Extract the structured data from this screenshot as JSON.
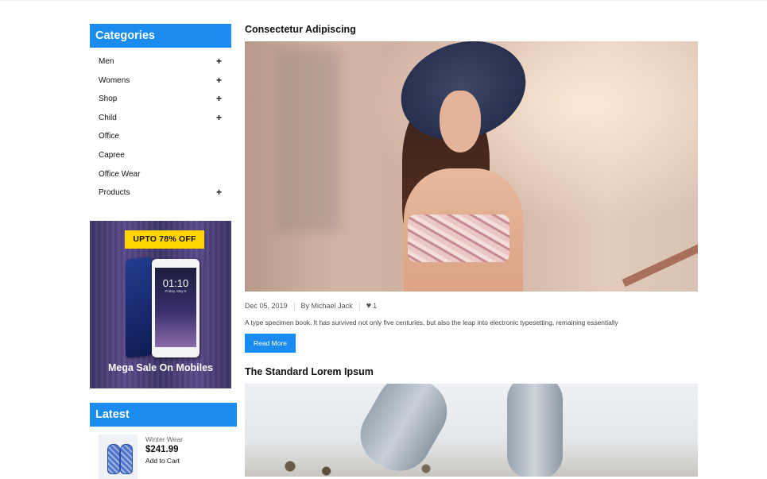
{
  "sidebar": {
    "categories_title": "Categories",
    "categories": [
      {
        "label": "Men",
        "expandable": true
      },
      {
        "label": "Womens",
        "expandable": true
      },
      {
        "label": "Shop",
        "expandable": true
      },
      {
        "label": "Child",
        "expandable": true
      },
      {
        "label": "Office",
        "expandable": false
      },
      {
        "label": "Capree",
        "expandable": false
      },
      {
        "label": "Office Wear",
        "expandable": false
      },
      {
        "label": "Products",
        "expandable": true
      }
    ],
    "expand_symbol": "+",
    "banner": {
      "badge": "UPTO 78% OFF",
      "phone_time": "01:10",
      "phone_date": "Friday, May 5",
      "caption": "Mega Sale On Mobiles"
    },
    "latest_title": "Latest",
    "latest_product": {
      "category": "Winter Wear",
      "price": "$241.99",
      "cart_label": "Add to Cart"
    }
  },
  "posts": [
    {
      "title": "Consectetur Adipiscing",
      "date": "Dec 05, 2019",
      "author": "By Michael Jack",
      "likes": "1",
      "excerpt": "A type specimen book. It has survived not only five centuries, but also the leap into electronic typesetting, remaining essentially",
      "read_more": "Read More"
    },
    {
      "title": "The Standard Lorem Ipsum"
    }
  ],
  "colors": {
    "accent": "#1a8cf0",
    "badge": "#ffd400"
  },
  "icons": {
    "like": "heart-icon",
    "expand": "plus-icon"
  }
}
